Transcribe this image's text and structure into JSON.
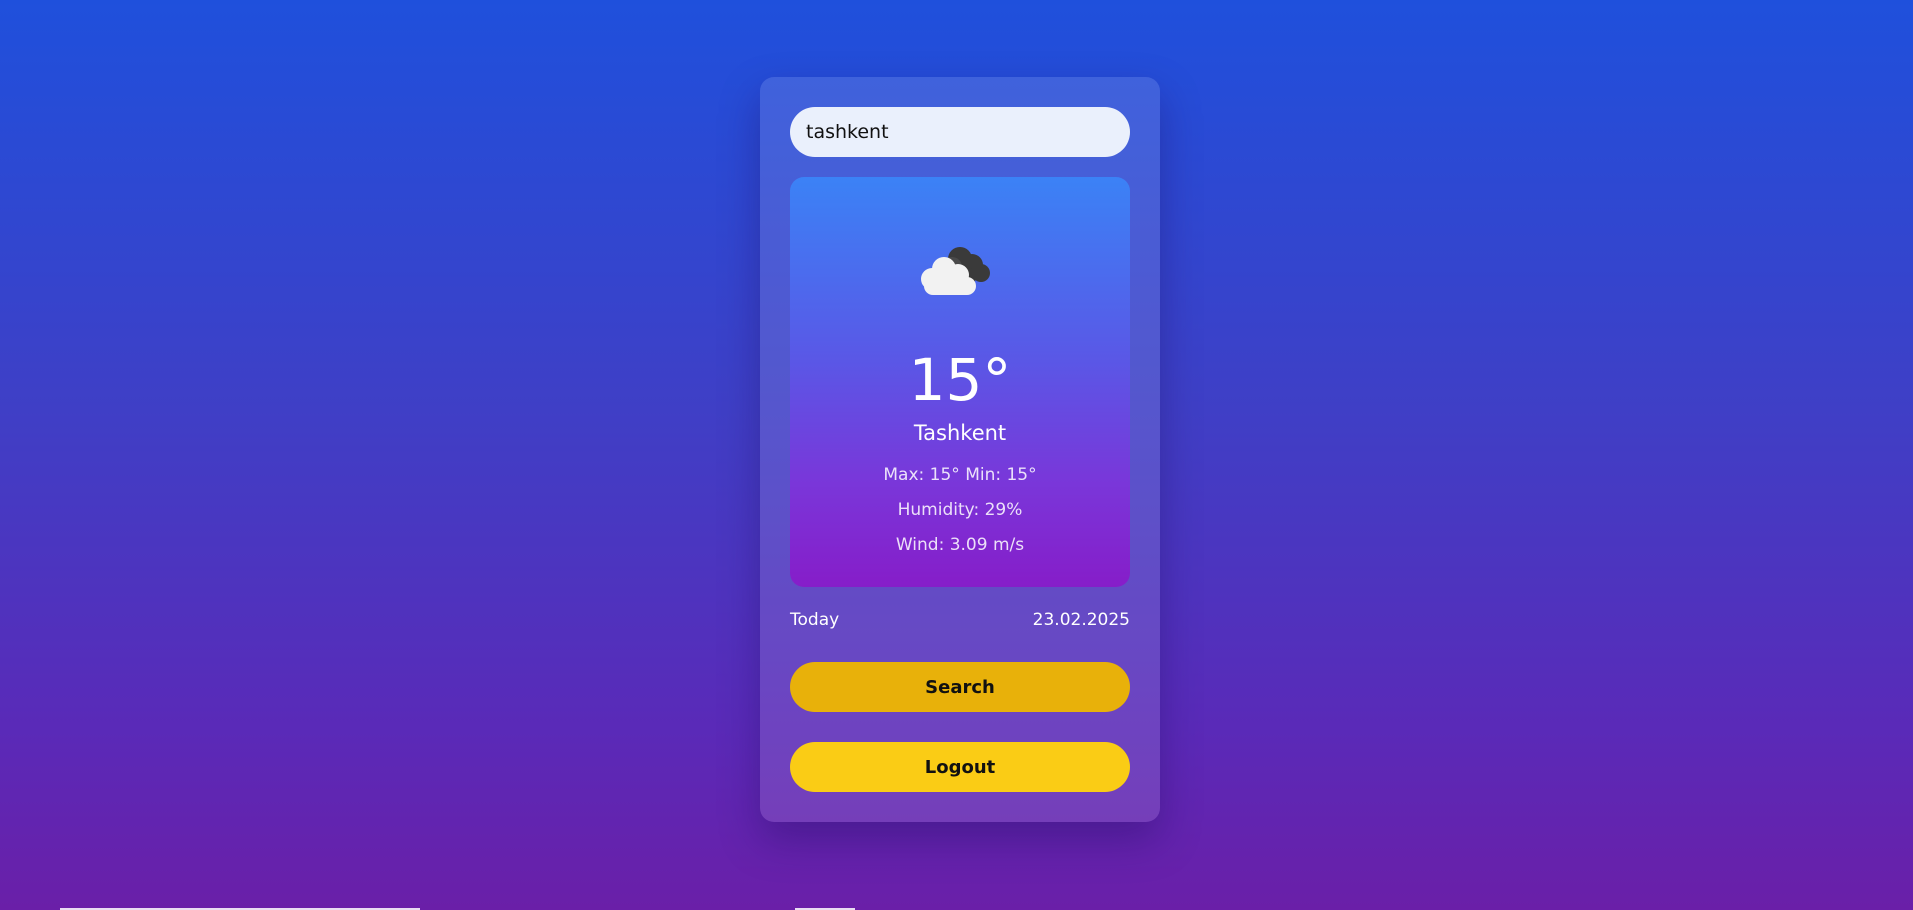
{
  "search": {
    "value": "tashkent",
    "placeholder": ""
  },
  "weather": {
    "icon": "cloud-icon",
    "temperature": "15°",
    "city": "Tashkent",
    "max_min": "Max: 15° Min: 15°",
    "humidity": "Humidity: 29%",
    "wind": "Wind: 3.09 m/s"
  },
  "date_row": {
    "label": "Today",
    "date": "23.02.2025"
  },
  "buttons": {
    "search_label": "Search",
    "logout_label": "Logout"
  },
  "colors": {
    "search_button": "#e8b10a",
    "logout_button": "#facc15",
    "input_background": "#eaf0fc"
  }
}
